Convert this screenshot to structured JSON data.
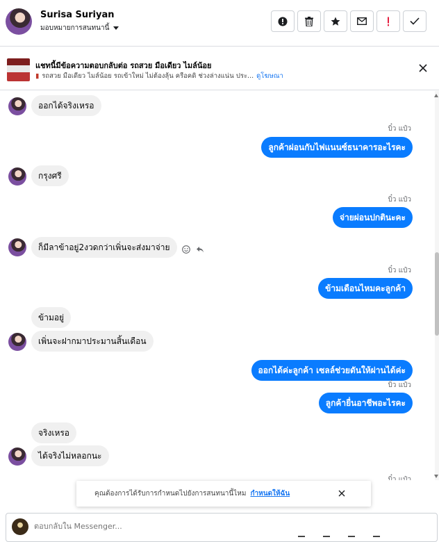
{
  "header": {
    "name": "Surisa Suriyan",
    "subtitle": "มอบหมายการสนทนานี้",
    "buttons": [
      {
        "icon": "alert-circle-icon"
      },
      {
        "icon": "trash-icon"
      },
      {
        "icon": "star-icon"
      },
      {
        "icon": "mail-icon"
      },
      {
        "icon": "exclamation-icon",
        "color": "#e41e3f"
      },
      {
        "icon": "check-icon"
      }
    ]
  },
  "ad": {
    "title": "แชทนี้มีข้อความตอบกลับต่อ รถสวย มือเดียว ไมล์น้อย",
    "description": "รถสวย มือเดียว ไมล์น้อย รถเข้าใหม่ ไม่ต้องลุ้น ครือคดิ ช่วงล่างแน่น ประ...",
    "link": "ดูโฆษณา"
  },
  "messages": [
    {
      "dir": "in",
      "text": "ออกได้จริงเหรอ"
    },
    {
      "dir": "out",
      "sender": "บิ๋ว แป๋ว",
      "text": "ลูกค้าผ่อนกับไฟแนนซ์ธนาคารอะไรคะ"
    },
    {
      "dir": "in",
      "text": "กรุงศรี"
    },
    {
      "dir": "out",
      "sender": "บิ๋ว แป๋ว",
      "text": "จ่ายผ่อนปกตินะคะ"
    },
    {
      "dir": "in",
      "text": "ก็มีลาข้าอยู่2งวดกว่าเพิ่นจะส่งมาจ่าย"
    },
    {
      "dir": "out",
      "sender": "บิ๋ว แป๋ว",
      "text": "ข้ามเดือนไหมคะลูกค้า"
    },
    {
      "dir": "in",
      "text": "ข้ามอยู่"
    },
    {
      "dir": "in",
      "text": "เพิ่นจะฝากมาประมานสิ้นเดือน"
    },
    {
      "dir": "out",
      "text": "ออกได้ค่ะลูกค้า  เซลล์ช่วยดันให้ผ่านได้ค่ะ"
    },
    {
      "dir": "out",
      "sender": "บิ๋ว แป๋ว",
      "text": "ลูกค้ายื่นอาชีพอะไรคะ"
    },
    {
      "dir": "in",
      "text": "จริงเหรอ"
    },
    {
      "dir": "in",
      "text": "ได้จริงไม่หลอกนะ"
    },
    {
      "dir": "out",
      "sender": "บิ๋ว แป๋ว"
    }
  ],
  "toast": {
    "text": "คุณต้องการได้รับการกำหนดไปยังการสนทนานี้ไหม",
    "link": "กำหนดให้ฉัน"
  },
  "composer": {
    "placeholder": "ตอบกลับใน Messenger..."
  },
  "colors": {
    "accent": "#0a7cff",
    "incoming_bubble": "#f0f0f0",
    "link": "#1877f2"
  }
}
